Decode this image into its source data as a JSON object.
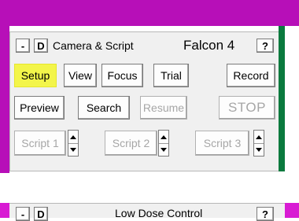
{
  "camera_panel": {
    "minimize_label": "-",
    "dock_label": "D",
    "title": "Camera & Script",
    "camera_name": "Falcon 4",
    "help_label": "?",
    "row1": [
      "Setup",
      "View",
      "Focus",
      "Trial",
      "Record"
    ],
    "row2": [
      "Preview",
      "Search",
      "Resume",
      "STOP"
    ],
    "scripts": [
      "Script 1",
      "Script 2",
      "Script 3"
    ]
  },
  "low_dose_panel": {
    "minimize_label": "-",
    "dock_label": "D",
    "title": "Low Dose Control",
    "help_label": "?"
  },
  "colors": {
    "window_border": "#b70fb8",
    "status_bar": "#0a7a3e",
    "highlight": "#f3f54a"
  }
}
